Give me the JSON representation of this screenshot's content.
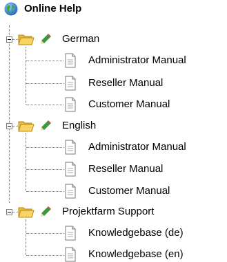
{
  "tree": {
    "root": {
      "label": "Online Help",
      "icon": "globe-icon"
    },
    "groups": [
      {
        "label": "German",
        "children": [
          "Administrator Manual",
          "Reseller Manual",
          "Customer Manual"
        ]
      },
      {
        "label": "English",
        "children": [
          "Administrator Manual",
          "Reseller Manual",
          "Customer Manual"
        ]
      },
      {
        "label": "Projektfarm Support",
        "children": [
          "Knowledgebase (de)",
          "Knowledgebase (en)"
        ]
      }
    ]
  },
  "colors": {
    "folder": "#f4c542",
    "pencil_body": "#3a9a3a",
    "pencil_tip": "#e0343a",
    "connector": "#777777"
  }
}
